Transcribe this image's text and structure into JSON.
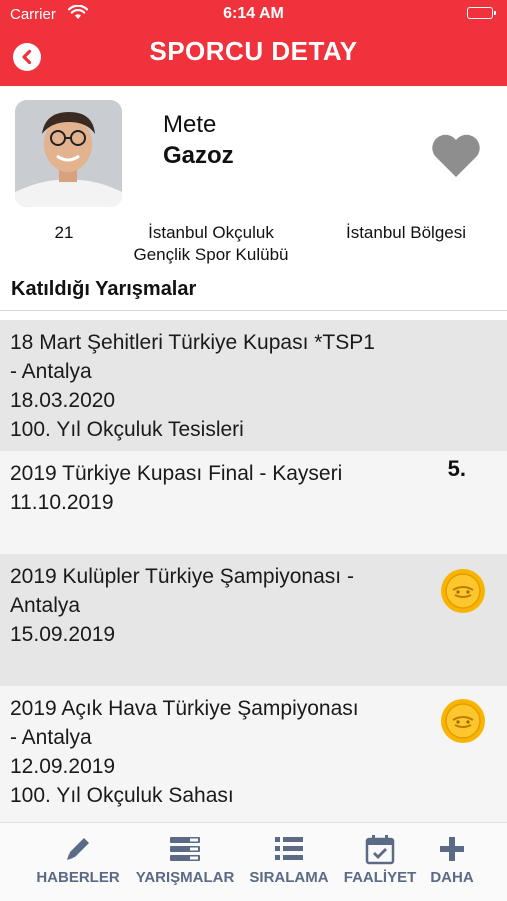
{
  "status_bar": {
    "carrier": "Carrier",
    "time": "6:14 AM"
  },
  "header": {
    "title": "SPORCU DETAY"
  },
  "athlete": {
    "first_name": "Mete",
    "last_name": "Gazoz",
    "age": "21",
    "club_line1": "İstanbul Okçuluk",
    "club_line2": "Gençlik Spor Kulübü",
    "region": "İstanbul Bölgesi"
  },
  "section_title": "Katıldığı Yarışmalar",
  "competitions": [
    {
      "lines": [
        "18 Mart Şehitleri Türkiye Kupası *TSP1",
        "- Antalya",
        "18.03.2020",
        "100. Yıl Okçuluk Tesisleri"
      ],
      "rank": "",
      "medal": "",
      "bg": "#e6e6e6"
    },
    {
      "lines": [
        "2019 Türkiye Kupası Final - Kayseri",
        "11.10.2019"
      ],
      "rank": "5.",
      "medal": "",
      "bg": "#f5f5f5"
    },
    {
      "lines": [
        "2019 Kulüpler Türkiye Şampiyonası -",
        "Antalya",
        "15.09.2019"
      ],
      "rank": "",
      "medal": "gold-medal-icon",
      "bg": "#e6e6e6"
    },
    {
      "lines": [
        "2019 Açık Hava Türkiye Şampiyonası",
        "- Antalya",
        "12.09.2019",
        "100. Yıl Okçuluk Sahası"
      ],
      "rank": "",
      "medal": "gold-medal-icon",
      "bg": "#f5f5f5"
    }
  ],
  "tabs": [
    {
      "label": "HABERLER",
      "icon": "pencil-icon"
    },
    {
      "label": "YARIŞMALAR",
      "icon": "competitions-icon"
    },
    {
      "label": "SIRALAMA",
      "icon": "list-icon"
    },
    {
      "label": "FAALİYET",
      "icon": "calendar-check-icon"
    },
    {
      "label": "DAHA",
      "icon": "plus-icon"
    }
  ],
  "colors": {
    "accent": "#f0323c",
    "tab_text": "#5b6a85",
    "heart": "#8e8e8e",
    "medal": "#f7b500"
  }
}
